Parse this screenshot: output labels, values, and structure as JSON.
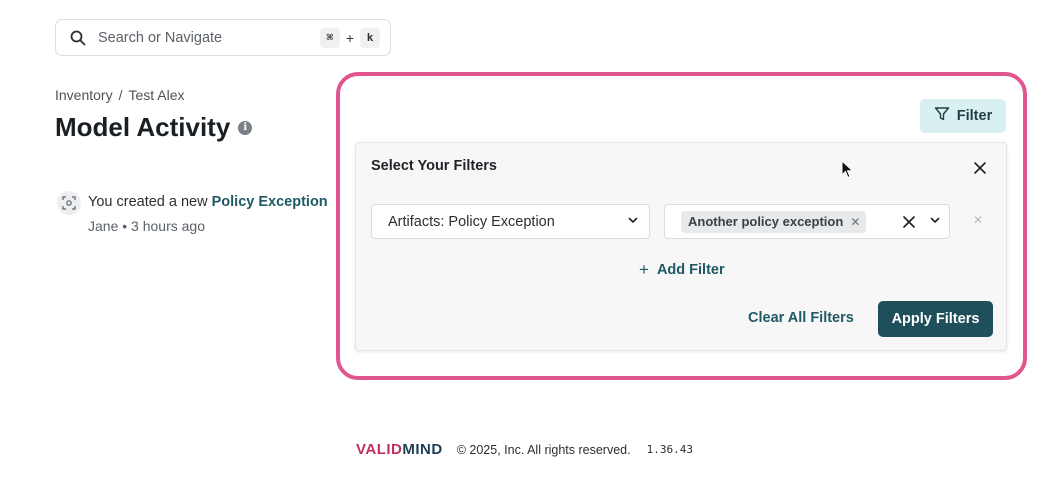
{
  "search": {
    "placeholder": "Search or Navigate",
    "shortcut_key_1": "⌘",
    "shortcut_plus": "+",
    "shortcut_key_2": "k"
  },
  "breadcrumb": {
    "items": [
      "Inventory",
      "Test Alex"
    ],
    "separator": "/"
  },
  "page": {
    "title": "Model Activity"
  },
  "activity": {
    "prefix": "You created a new",
    "link_text": "Policy Exception",
    "meta": "Jane • 3 hours ago"
  },
  "filter_button": {
    "label": "Filter"
  },
  "filter_panel": {
    "title": "Select Your Filters",
    "field_select_value": "Artifacts: Policy Exception",
    "value_chip": "Another policy exception",
    "add_filter_label": "Add Filter",
    "clear_all_label": "Clear All Filters",
    "apply_label": "Apply Filters"
  },
  "footer": {
    "logo_part_1": "VALID",
    "logo_part_2": "MIND",
    "copyright": "© 2025, Inc. All rights reserved.",
    "version": "1.36.43"
  },
  "colors": {
    "accent": "#1d5a63",
    "primary_button": "#1f4f5a",
    "filter_button_bg": "#d9f0f3",
    "highlight_border": "#e2568f"
  },
  "icons": [
    "search-icon",
    "info-icon",
    "activity-icon",
    "funnel-icon",
    "close-icon",
    "chevron-down-icon",
    "plus-icon",
    "mouse-cursor-icon"
  ]
}
